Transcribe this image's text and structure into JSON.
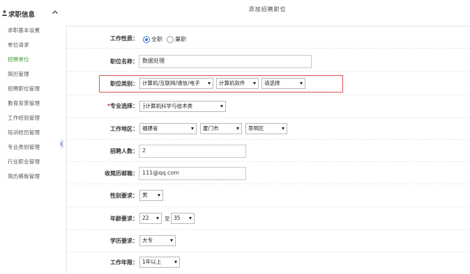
{
  "sidebar": {
    "title": "求职信息",
    "items": [
      {
        "label": "求职基本设置",
        "active": false
      },
      {
        "label": "单位请求",
        "active": false
      },
      {
        "label": "招聘单位",
        "active": true
      },
      {
        "label": "简历管理",
        "active": false
      },
      {
        "label": "招聘职位管理",
        "active": false
      },
      {
        "label": "教育背景管理",
        "active": false
      },
      {
        "label": "工作经验管理",
        "active": false
      },
      {
        "label": "培训经历管理",
        "active": false
      },
      {
        "label": "专业类别管理",
        "active": false
      },
      {
        "label": "行业职业管理",
        "active": false
      },
      {
        "label": "简历模板管理",
        "active": false
      }
    ]
  },
  "page": {
    "title": "添加招聘职位"
  },
  "form": {
    "job_nature": {
      "label": "工作性质：",
      "options": [
        "全职",
        "兼职"
      ],
      "selected": "全职"
    },
    "job_name": {
      "label": "职位名称：",
      "value": "数据处理"
    },
    "job_category": {
      "label": "职位类别：",
      "level1": "计算机/互联网/通信/电子",
      "level2": "计算机软件",
      "level3": "请选择"
    },
    "major": {
      "label": "专业选择：",
      "required_mark": "*",
      "value": "├计算机科学与技术类"
    },
    "work_area": {
      "label": "工作地区：",
      "province": "福建省",
      "city": "厦门市",
      "district": "思明区"
    },
    "headcount": {
      "label": "招聘人数：",
      "value": "2"
    },
    "resume_email": {
      "label": "收简历邮箱：",
      "value": "111@qq.com"
    },
    "gender": {
      "label": "性别要求：",
      "value": "男"
    },
    "age": {
      "label": "年龄要求：",
      "min": "22",
      "sep": "至",
      "max": "35"
    },
    "education": {
      "label": "学历要求：",
      "value": "大专"
    },
    "experience": {
      "label": "工作年限：",
      "value": "1年以上"
    }
  },
  "colors": {
    "accent": "#2a7ad8",
    "active_nav": "#3a9b3a",
    "highlight": "#e05050",
    "required": "#d9282e"
  }
}
